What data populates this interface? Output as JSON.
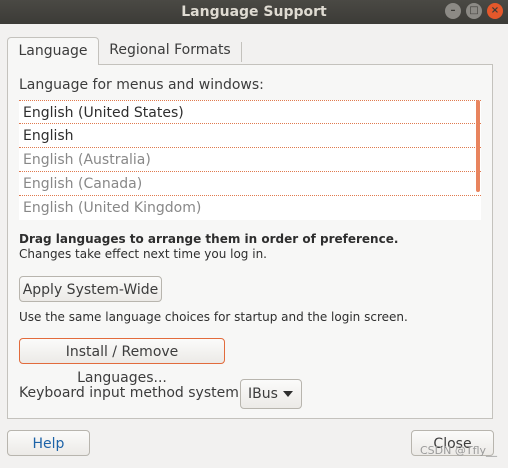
{
  "window": {
    "title": "Language Support",
    "controls": {
      "minimize": "–",
      "maximize": "□",
      "close": "×"
    }
  },
  "tabs": [
    {
      "label": "Language",
      "active": true
    },
    {
      "label": "Regional Formats",
      "active": false
    }
  ],
  "language_tab": {
    "heading": "Language for menus and windows:",
    "languages": [
      {
        "name": "English (United States)",
        "dim": false
      },
      {
        "name": "English",
        "dim": false
      },
      {
        "name": "English (Australia)",
        "dim": true
      },
      {
        "name": "English (Canada)",
        "dim": true
      },
      {
        "name": "English (United Kingdom)",
        "dim": true
      }
    ],
    "hint_bold": "Drag languages to arrange them in order of preference.",
    "hint": "Changes take effect next time you log in.",
    "apply_button": "Apply System-Wide",
    "apply_note": "Use the same language choices for startup and the login screen.",
    "install_button": "Install / Remove Languages...",
    "keyboard_label": "Keyboard input method system:",
    "keyboard_value": "IBus"
  },
  "footer": {
    "help_button": "Help",
    "close_button": "Close",
    "watermark": "CSDN @Tfly__"
  },
  "colors": {
    "accent": "#e26b3c",
    "titlebar": "#3c3b37",
    "window_bg": "#f2f1f0"
  }
}
